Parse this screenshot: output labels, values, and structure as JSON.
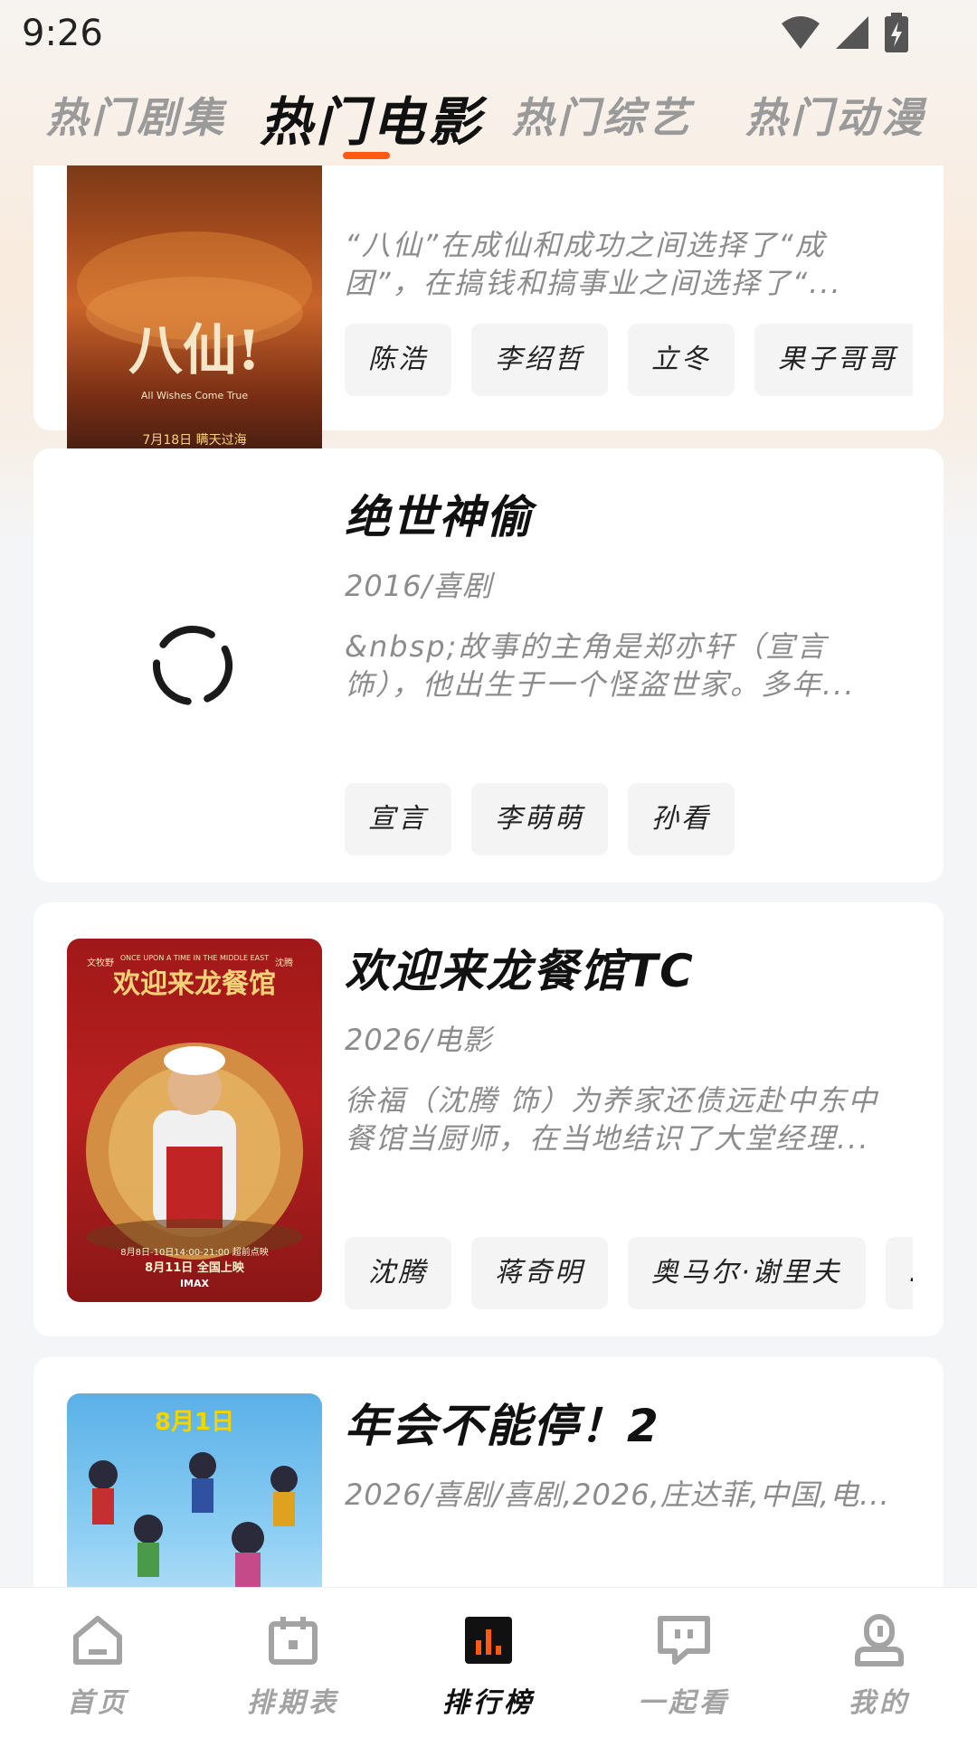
{
  "status_bar": {
    "time": "9:26"
  },
  "top_tabs": [
    {
      "label": "热门剧集",
      "active": false
    },
    {
      "label": "热门电影",
      "active": true
    },
    {
      "label": "热门综艺",
      "active": false
    },
    {
      "label": "热门动漫",
      "active": false
    }
  ],
  "movies": [
    {
      "title": "",
      "meta": "",
      "desc_lines": [
        "“八仙”在成仙和成功之间选择了“成",
        "团”，在搞钱和搞事业之间选择了“..."
      ],
      "tags": [
        "陈浩",
        "李绍哲",
        "立冬",
        "果子哥哥"
      ],
      "poster_text": {
        "title": "八仙!",
        "subtitle": "All Wishes Come True",
        "date": "7月18日 瞒天过海"
      }
    },
    {
      "title": "绝世神偷",
      "meta": "2016/喜剧",
      "desc_lines": [
        "&nbsp;故事的主角是郑亦轩（宣言",
        "饰），他出生于一个怪盗世家。多年..."
      ],
      "tags": [
        "宣言",
        "李萌萌",
        "孙看"
      ]
    },
    {
      "title": "欢迎来龙餐馆TC",
      "meta": "2026/电影",
      "desc_lines": [
        "徐福（沈腾 饰）为养家还债远赴中东中",
        "餐馆当厨师，在当地结识了大堂经理..."
      ],
      "tags": [
        "沈腾",
        "蒋奇明",
        "奥马尔·谢里夫",
        "…"
      ],
      "poster_text": {
        "title": "欢迎来龙餐馆",
        "en": "ONCE UPON A TIME IN THE MIDDLE EAST",
        "left": "文牧野",
        "right": "沈腾",
        "date1": "8月8日-10日14:00-21:00 超前点映",
        "date2": "8月11日 全国上映",
        "imax": "IMAX"
      }
    },
    {
      "title": "年会不能停！2",
      "meta": "2026/喜剧/喜剧,2026,庄达菲,中国,电...",
      "desc_lines": [],
      "tags": [],
      "poster_text": {
        "date": "8月1日"
      }
    }
  ],
  "bottom_nav": [
    {
      "label": "首页",
      "icon": "home-icon",
      "active": false
    },
    {
      "label": "排期表",
      "icon": "calendar-icon",
      "active": false
    },
    {
      "label": "排行榜",
      "icon": "chart-icon",
      "active": true
    },
    {
      "label": "一起看",
      "icon": "chat-icon",
      "active": false
    },
    {
      "label": "我的",
      "icon": "profile-icon",
      "active": false
    }
  ],
  "colors": {
    "accent": "#ff5a12",
    "active_text": "#111111",
    "inactive_text": "#a3a3a3"
  }
}
